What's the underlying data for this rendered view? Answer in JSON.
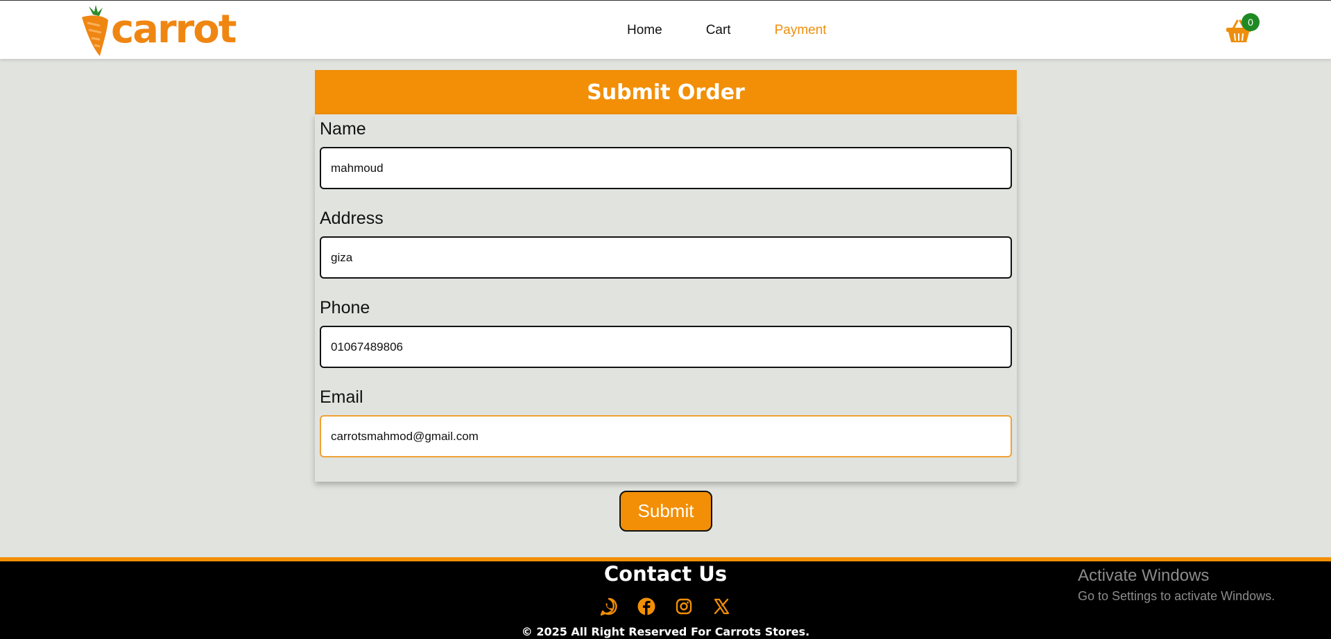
{
  "brand": {
    "logo_text": "carrot"
  },
  "nav": {
    "items": [
      {
        "label": "Home",
        "active": false
      },
      {
        "label": "Cart",
        "active": false
      },
      {
        "label": "Payment",
        "active": true
      }
    ]
  },
  "cart": {
    "count": "0",
    "icon": "basket-icon"
  },
  "form": {
    "title": "Submit Order",
    "fields": [
      {
        "label": "Name",
        "value": "mahmoud"
      },
      {
        "label": "Address",
        "value": "giza"
      },
      {
        "label": "Phone",
        "value": "01067489806"
      },
      {
        "label": "Email",
        "value": "carrotsmahmod@gmail.com",
        "focused": true
      }
    ],
    "submit_label": "Submit"
  },
  "footer": {
    "contact_title": "Contact Us",
    "socials": [
      "whatsapp-icon",
      "facebook-icon",
      "instagram-icon",
      "x-icon"
    ],
    "copyright": "© 2025 All Right Reserved For Carrots Stores."
  },
  "watermark": {
    "title": "Activate Windows",
    "subtitle": "Go to Settings to activate Windows."
  },
  "colors": {
    "accent": "#f28f07",
    "background": "#e1e3df",
    "badge": "#1f8a24",
    "footer": "#000000"
  }
}
